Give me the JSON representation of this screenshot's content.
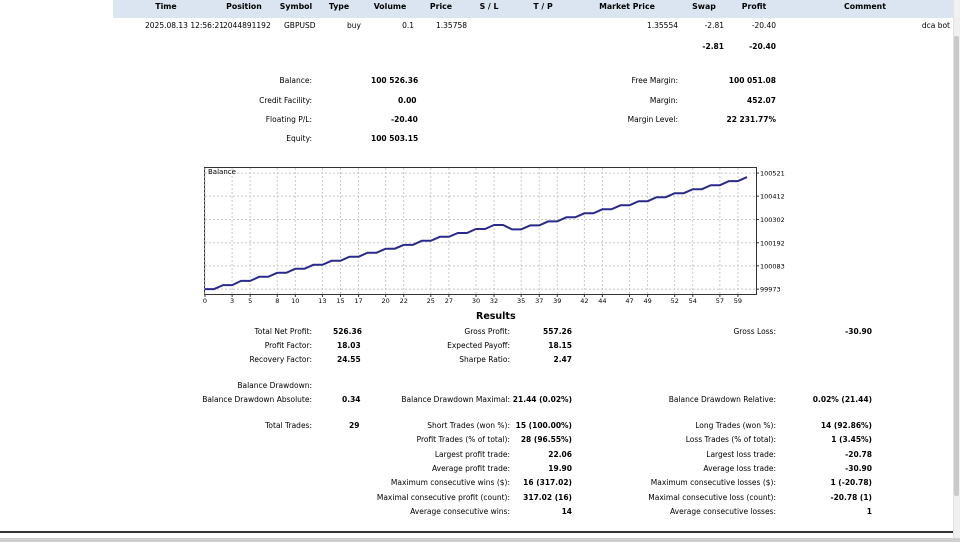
{
  "table": {
    "headers": [
      "Time",
      "Position",
      "Symbol",
      "Type",
      "Volume",
      "Price",
      "S / L",
      "T / P",
      "Market Price",
      "Swap",
      "Profit",
      "Comment"
    ],
    "row": {
      "time": "2025.08.13 12:56:21",
      "position": "2044891192",
      "symbol": "GBPUSD",
      "type": "buy",
      "volume": "0.1",
      "price": "1.35758",
      "market_price": "1.35554",
      "swap": "-2.81",
      "profit": "-20.40",
      "comment": "dca bot"
    },
    "totals": {
      "swap": "-2.81",
      "profit": "-20.40"
    }
  },
  "account": {
    "balance_label": "Balance:",
    "balance": "100 526.36",
    "credit_label": "Credit Facility:",
    "credit": "0.00",
    "floating_label": "Floating P/L:",
    "floating": "-20.40",
    "equity_label": "Equity:",
    "equity": "100 503.15",
    "free_margin_label": "Free Margin:",
    "free_margin": "100 051.08",
    "margin_label": "Margin:",
    "margin": "452.07",
    "margin_level_label": "Margin Level:",
    "margin_level": "22 231.77%"
  },
  "chart_data": {
    "type": "line",
    "title": "Balance",
    "x_ticks": [
      0,
      3,
      5,
      8,
      10,
      13,
      15,
      17,
      20,
      22,
      25,
      27,
      30,
      32,
      35,
      37,
      39,
      42,
      44,
      47,
      49,
      52,
      54,
      57,
      59
    ],
    "y_ticks": [
      99973,
      100083,
      100192,
      100302,
      100412,
      100521
    ],
    "xlim": [
      0,
      61
    ],
    "ylim": [
      99950,
      100545
    ],
    "series": [
      {
        "color": "#2a2a8c",
        "x": [
          0,
          1,
          2,
          3,
          4,
          5,
          6,
          7,
          8,
          9,
          10,
          11,
          12,
          13,
          14,
          15,
          16,
          17,
          18,
          19,
          20,
          21,
          22,
          23,
          24,
          25,
          26,
          27,
          28,
          29,
          30,
          31,
          32,
          33,
          34,
          35,
          36,
          37,
          38,
          39,
          40,
          41,
          42,
          43,
          44,
          45,
          46,
          47,
          48,
          49,
          50,
          51,
          52,
          53,
          54,
          55,
          56,
          57,
          58,
          59,
          60
        ],
        "values": [
          99973,
          99973,
          99992,
          99992,
          100012,
          100012,
          100031,
          100031,
          100050,
          100050,
          100069,
          100069,
          100088,
          100088,
          100107,
          100107,
          100126,
          100126,
          100145,
          100145,
          100164,
          100164,
          100182,
          100182,
          100201,
          100201,
          100220,
          100220,
          100238,
          100238,
          100257,
          100257,
          100276,
          100276,
          100255,
          100255,
          100274,
          100274,
          100293,
          100293,
          100312,
          100312,
          100331,
          100331,
          100350,
          100350,
          100369,
          100369,
          100388,
          100388,
          100407,
          100407,
          100426,
          100426,
          100445,
          100445,
          100464,
          100464,
          100483,
          100483,
          100502
        ]
      }
    ]
  },
  "results": {
    "title": "Results",
    "total_net_profit_label": "Total Net Profit:",
    "total_net_profit": "526.36",
    "gross_profit_label": "Gross Profit:",
    "gross_profit": "557.26",
    "gross_loss_label": "Gross Loss:",
    "gross_loss": "-30.90",
    "profit_factor_label": "Profit Factor:",
    "profit_factor": "18.03",
    "expected_payoff_label": "Expected Payoff:",
    "expected_payoff": "18.15",
    "recovery_factor_label": "Recovery Factor:",
    "recovery_factor": "24.55",
    "sharpe_ratio_label": "Sharpe Ratio:",
    "sharpe_ratio": "2.47",
    "balance_drawdown_label": "Balance Drawdown:",
    "dd_absolute_label": "Balance Drawdown Absolute:",
    "dd_absolute": "0.34",
    "dd_maximal_label": "Balance Drawdown Maximal:",
    "dd_maximal": "21.44 (0.02%)",
    "dd_relative_label": "Balance Drawdown Relative:",
    "dd_relative": "0.02% (21.44)",
    "total_trades_label": "Total Trades:",
    "total_trades": "29",
    "short_trades_label": "Short Trades (won %):",
    "short_trades": "15 (100.00%)",
    "long_trades_label": "Long Trades (won %):",
    "long_trades": "14 (92.86%)",
    "profit_trades_label": "Profit Trades (% of total):",
    "profit_trades": "28 (96.55%)",
    "loss_trades_label": "Loss Trades (% of total):",
    "loss_trades": "1 (3.45%)",
    "largest_profit_label": "Largest profit trade:",
    "largest_profit": "22.06",
    "largest_loss_label": "Largest loss trade:",
    "largest_loss": "-20.78",
    "avg_profit_label": "Average profit trade:",
    "avg_profit": "19.90",
    "avg_loss_label": "Average loss trade:",
    "avg_loss": "-30.90",
    "max_cons_wins_label": "Maximum consecutive wins ($):",
    "max_cons_wins": "16 (317.02)",
    "max_cons_losses_label": "Maximum consecutive losses ($):",
    "max_cons_losses": "1 (-20.78)",
    "max_cons_profit_label": "Maximal consecutive profit (count):",
    "max_cons_profit": "317.02 (16)",
    "max_cons_loss_label": "Maximal consecutive loss (count):",
    "max_cons_loss": "-20.78 (1)",
    "avg_cons_wins_label": "Average consecutive wins:",
    "avg_cons_wins": "14",
    "avg_cons_losses_label": "Average consecutive losses:",
    "avg_cons_losses": "1"
  }
}
